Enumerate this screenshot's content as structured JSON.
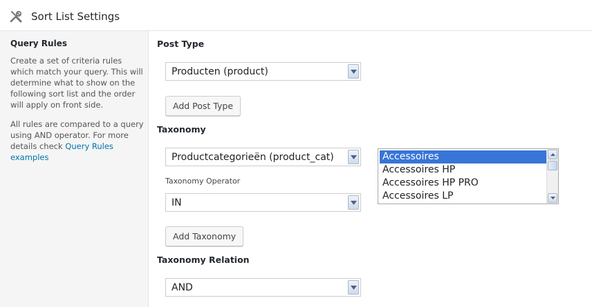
{
  "header": {
    "title": "Sort List Settings",
    "icon": "tools-icon"
  },
  "sidebar": {
    "title": "Query Rules",
    "description": "Create a set of criteria rules which match your query. This will determine what to show on the following sort list and the order will apply on front side.",
    "description2_prefix": "All rules are compared to a query using AND operator. For more details check",
    "link_text": "Query Rules examples"
  },
  "main": {
    "post_type_label": "Post Type",
    "post_type_value": "Producten (product)",
    "add_post_type_label": "Add Post Type",
    "taxonomy_label": "Taxonomy",
    "taxonomy_value": "Productcategorieën (product_cat)",
    "taxonomy_operator_label": "Taxonomy Operator",
    "taxonomy_operator_value": "IN",
    "add_taxonomy_label": "Add Taxonomy",
    "taxonomy_relation_label": "Taxonomy Relation",
    "taxonomy_relation_value": "AND",
    "terms": {
      "items": [
        "Accessoires",
        "Accessoires HP",
        "Accessoires HP PRO",
        "Accessoires LP"
      ],
      "selected": "Accessoires"
    }
  },
  "colors": {
    "accent": "#0073aa",
    "selection": "#3875d7"
  }
}
